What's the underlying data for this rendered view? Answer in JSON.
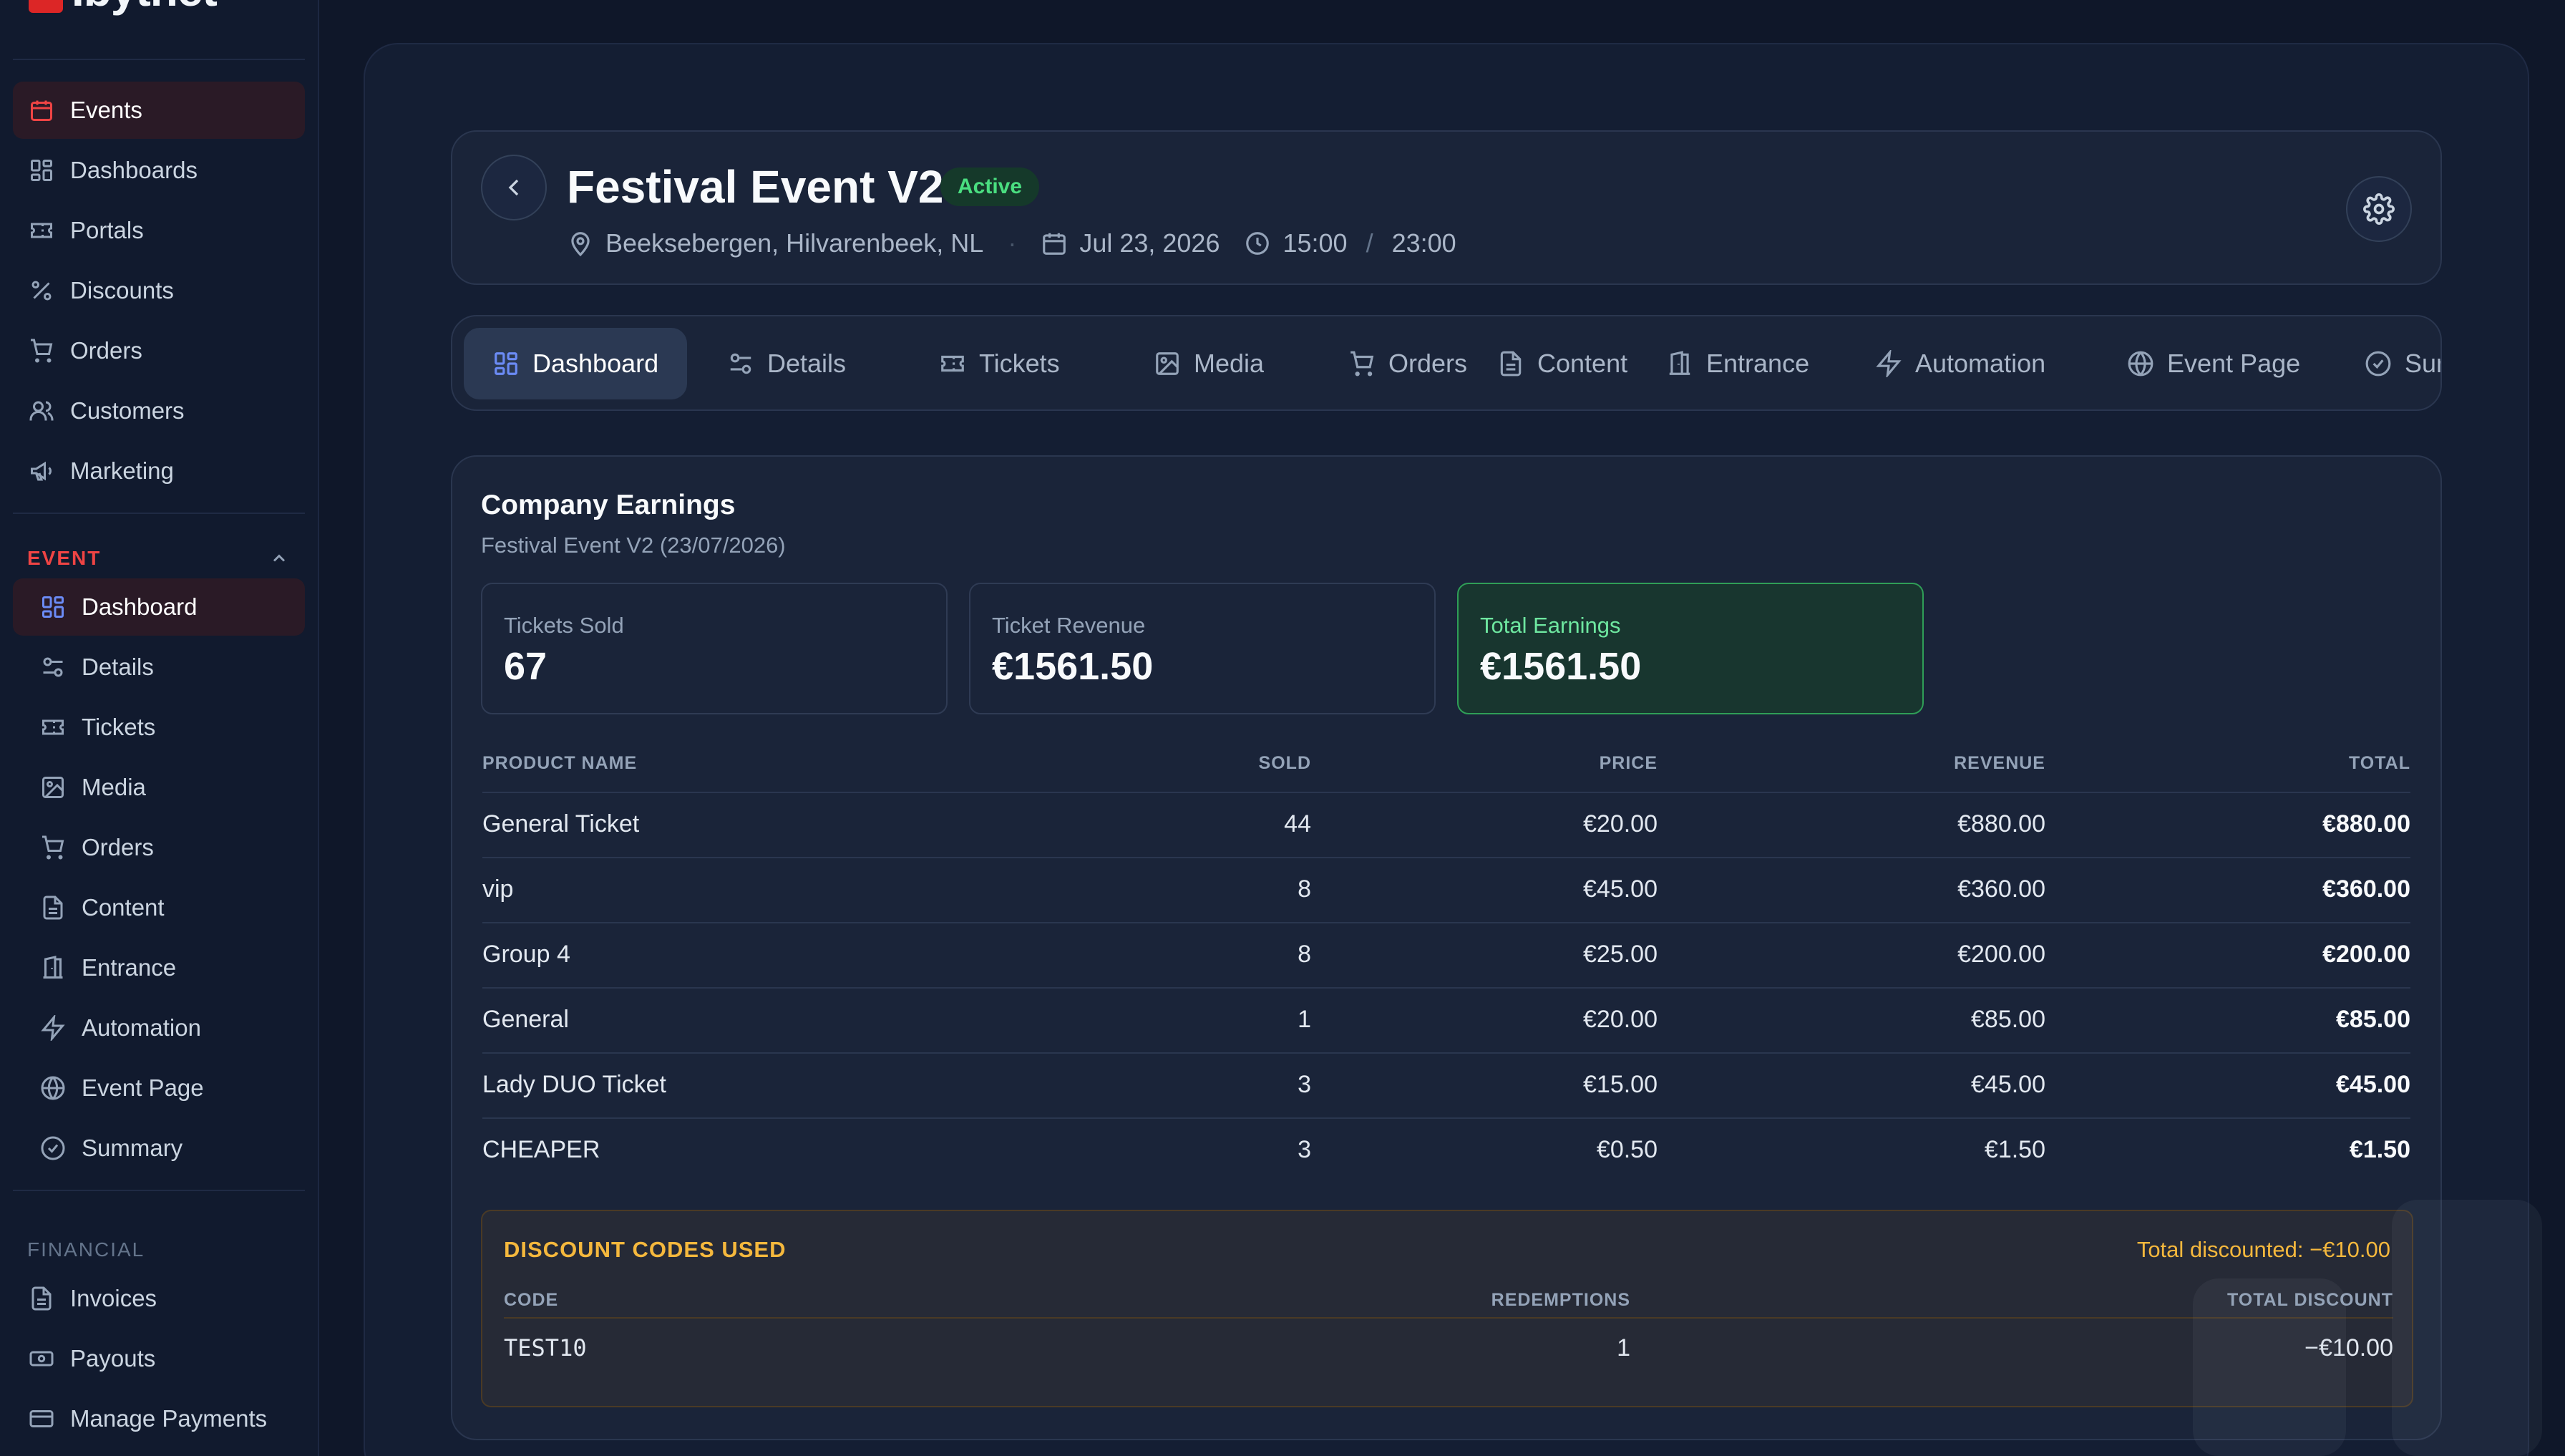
{
  "brand": {
    "name": "Ibytnet",
    "accent": "#dc2626"
  },
  "sidebar": {
    "main_items": [
      {
        "label": "Events",
        "icon": "calendar-icon",
        "active": true
      },
      {
        "label": "Dashboards",
        "icon": "grid-icon"
      },
      {
        "label": "Portals",
        "icon": "ticket-icon"
      },
      {
        "label": "Discounts",
        "icon": "percent-icon"
      },
      {
        "label": "Orders",
        "icon": "cart-icon"
      },
      {
        "label": "Customers",
        "icon": "users-icon"
      },
      {
        "label": "Marketing",
        "icon": "megaphone-icon"
      }
    ],
    "event_section_label": "EVENT",
    "event_items": [
      {
        "label": "Dashboard",
        "icon": "grid-icon",
        "active": true
      },
      {
        "label": "Details",
        "icon": "sliders-icon"
      },
      {
        "label": "Tickets",
        "icon": "ticket-icon"
      },
      {
        "label": "Media",
        "icon": "image-icon"
      },
      {
        "label": "Orders",
        "icon": "cart-icon"
      },
      {
        "label": "Content",
        "icon": "document-icon"
      },
      {
        "label": "Entrance",
        "icon": "door-icon"
      },
      {
        "label": "Automation",
        "icon": "lightning-icon"
      },
      {
        "label": "Event Page",
        "icon": "globe-icon"
      },
      {
        "label": "Summary",
        "icon": "check-circle-icon"
      }
    ],
    "financial_section_label": "FINANCIAL",
    "financial_items": [
      {
        "label": "Invoices",
        "icon": "document-icon"
      },
      {
        "label": "Payouts",
        "icon": "banknote-icon"
      },
      {
        "label": "Manage Payments",
        "icon": "card-icon"
      }
    ]
  },
  "event": {
    "title": "Festival Event V2",
    "status": "Active",
    "location": "Beeksebergen, Hilvarenbeek, NL",
    "date": "Jul 23, 2026",
    "start_time": "15:00",
    "end_time": "23:00"
  },
  "tabs": [
    {
      "label": "Dashboard",
      "icon": "grid-icon",
      "active": true
    },
    {
      "label": "Details",
      "icon": "sliders-icon"
    },
    {
      "label": "Tickets",
      "icon": "ticket-icon"
    },
    {
      "label": "Media",
      "icon": "image-icon"
    },
    {
      "label": "Orders",
      "icon": "cart-icon"
    },
    {
      "label": "Content",
      "icon": "document-icon"
    },
    {
      "label": "Entrance",
      "icon": "door-icon"
    },
    {
      "label": "Automation",
      "icon": "lightning-icon"
    },
    {
      "label": "Event Page",
      "icon": "globe-icon"
    },
    {
      "label": "Summary",
      "icon": "check-circle-icon"
    }
  ],
  "earnings": {
    "title": "Company Earnings",
    "subtitle": "Festival Event V2 (23/07/2026)",
    "stats": [
      {
        "label": "Tickets Sold",
        "value": "67"
      },
      {
        "label": "Ticket Revenue",
        "value": "€1561.50"
      },
      {
        "label": "Total Earnings",
        "value": "€1561.50",
        "highlight": true
      }
    ],
    "columns": {
      "name": "PRODUCT NAME",
      "sold": "SOLD",
      "price": "PRICE",
      "revenue": "REVENUE",
      "total": "TOTAL"
    },
    "rows": [
      {
        "name": "General Ticket",
        "sold": "44",
        "price": "€20.00",
        "revenue": "€880.00",
        "total": "€880.00"
      },
      {
        "name": "vip",
        "sold": "8",
        "price": "€45.00",
        "revenue": "€360.00",
        "total": "€360.00"
      },
      {
        "name": "Group 4",
        "sold": "8",
        "price": "€25.00",
        "revenue": "€200.00",
        "total": "€200.00"
      },
      {
        "name": "General",
        "sold": "1",
        "price": "€20.00",
        "revenue": "€85.00",
        "total": "€85.00"
      },
      {
        "name": "Lady DUO Ticket",
        "sold": "3",
        "price": "€15.00",
        "revenue": "€45.00",
        "total": "€45.00"
      },
      {
        "name": "CHEAPER",
        "sold": "3",
        "price": "€0.50",
        "revenue": "€1.50",
        "total": "€1.50"
      }
    ]
  },
  "discounts": {
    "title": "DISCOUNT CODES USED",
    "total_label": "Total discounted: −€10.00",
    "columns": {
      "code": "CODE",
      "redemptions": "REDEMPTIONS",
      "total": "TOTAL DISCOUNT"
    },
    "rows": [
      {
        "code": "TEST10",
        "redemptions": "1",
        "total": "−€10.00"
      }
    ]
  },
  "colors": {
    "background": "#0f1729",
    "active_green": "#4ade80",
    "discount_amber": "#f5b83d",
    "tab_icon_active": "#6b8bf5"
  }
}
